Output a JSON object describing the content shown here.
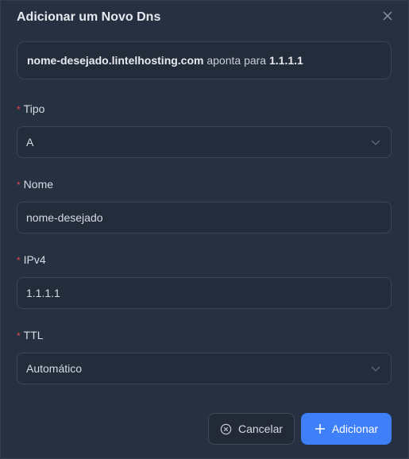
{
  "dialog": {
    "title": "Adicionar um Novo Dns"
  },
  "preview": {
    "host": "nome-desejado.lintelhosting.com",
    "middle": "aponta para",
    "target": "1.1.1.1"
  },
  "form": {
    "required_mark": "*",
    "tipo": {
      "label": "Tipo",
      "value": "A"
    },
    "nome": {
      "label": "Nome",
      "value": "nome-desejado"
    },
    "ipv4": {
      "label": "IPv4",
      "value": "1.1.1.1"
    },
    "ttl": {
      "label": "TTL",
      "value": "Automático"
    }
  },
  "buttons": {
    "cancel": "Cancelar",
    "add": "Adicionar"
  },
  "colors": {
    "background": "#263040",
    "primary": "#3f80f8",
    "required": "#e5484d"
  }
}
